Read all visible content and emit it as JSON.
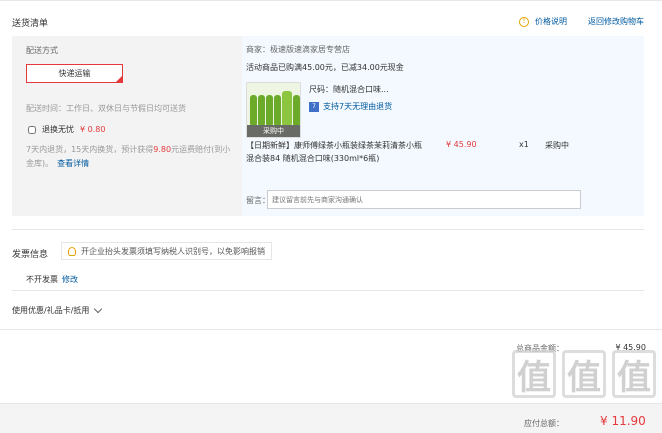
{
  "header": {
    "title": "送货清单",
    "price_info": "价格说明",
    "back_cart": "返回修改购物车"
  },
  "shipping": {
    "label": "配送方式",
    "method": "快递运输",
    "delivery_time": "配送时间：工作日、双休日与节假日均可送货",
    "insurance_label": "退换无忧",
    "insurance_price": "¥ 0.80",
    "insurance_desc_1": "7天内退货，15天内换货，预计获得",
    "insurance_highlight": "9.80",
    "insurance_desc_2": "元运费赔付(到小金库)。",
    "insurance_link": "查看详情"
  },
  "order": {
    "merchant": "商家：极速版速滴家居专营店",
    "promo": "活动商品已购满45.00元，已减34.00元现金",
    "product_tag": "采购中",
    "spec": "尺码：随机混合口味...",
    "return_icon": "7",
    "return_policy": "支持7天无理由退货",
    "product_name": "【日期新鲜】康师傅绿茶小瓶装绿茶茉莉清茶小瓶混合装84 随机混合口味(330ml*6瓶)",
    "price": "¥ 45.90",
    "quantity": "x1",
    "stock": "采购中",
    "note_label": "留言：",
    "note_placeholder": "建议留言前先与商家沟通确认"
  },
  "invoice": {
    "title": "发票信息",
    "tip": "开企业抬头发票须填写纳税人识别号，以免影响报销",
    "status": "不开发票",
    "edit": "修改"
  },
  "coupon": {
    "label": "使用优惠/礼品卡/抵用"
  },
  "summary": {
    "total_label": "总商品金额：",
    "total_value": "¥ 45.90",
    "pay_label": "应付总额：",
    "pay_value": "¥ 11.90"
  },
  "watermark": {
    "chars": [
      "值",
      "值",
      "值"
    ],
    "url": "zhizhi.com"
  },
  "colors": {
    "accent_red": "#e4393c",
    "link_blue": "#005aa0",
    "panel_blue": "#f3f9fe",
    "panel_gray": "#f3f3f3"
  }
}
